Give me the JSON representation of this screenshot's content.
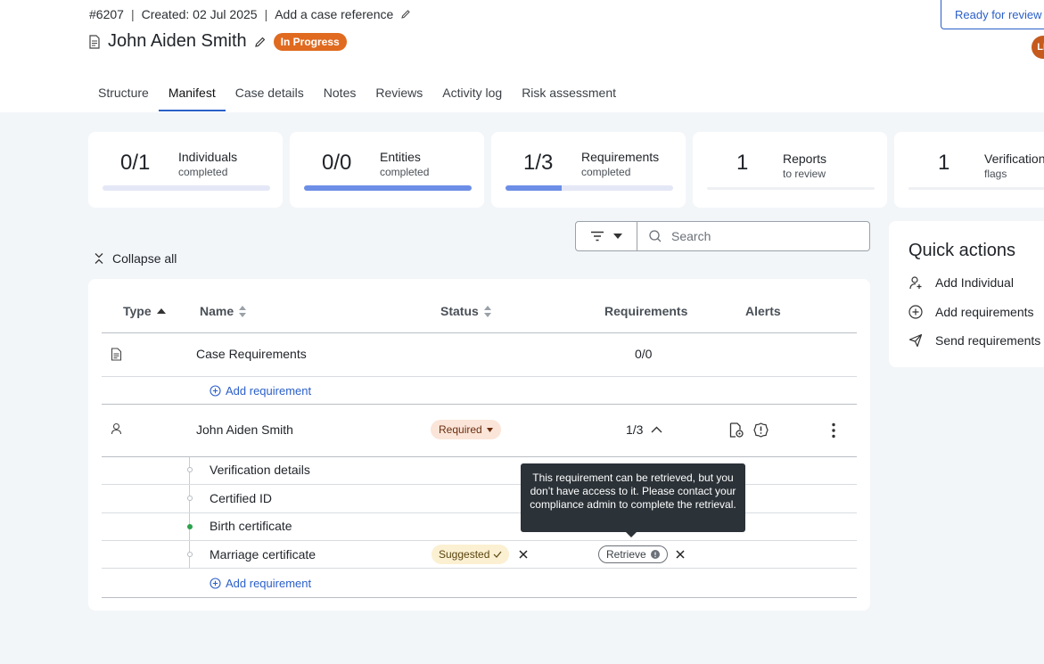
{
  "header": {
    "case_id": "#6207",
    "created": "Created: 02 Jul 2025",
    "case_reference": "Add a case reference",
    "title": "John Aiden Smith",
    "status": "In Progress",
    "ready_button": "Ready for review",
    "avatar_initials": "LL"
  },
  "tabs": [
    {
      "label": "Structure"
    },
    {
      "label": "Manifest"
    },
    {
      "label": "Case details"
    },
    {
      "label": "Notes"
    },
    {
      "label": "Reviews"
    },
    {
      "label": "Activity log"
    },
    {
      "label": "Risk assessment"
    }
  ],
  "stats": [
    {
      "value": "0/1",
      "label": "Individuals",
      "sub": "completed",
      "progress": 0
    },
    {
      "value": "0/0",
      "label": "Entities",
      "sub": "completed",
      "progress": 1
    },
    {
      "value": "1/3",
      "label": "Requirements",
      "sub": "completed",
      "progress": 0.333
    },
    {
      "value": "1",
      "label": "Reports",
      "sub": "to review"
    },
    {
      "value": "1",
      "label": "Verification",
      "sub": "flags"
    }
  ],
  "toolbar": {
    "search_placeholder": "Search",
    "collapse_label": "Collapse all"
  },
  "quick_actions": {
    "title": "Quick actions",
    "items": [
      {
        "label": "Add Individual",
        "icon": "add-person-icon"
      },
      {
        "label": "Add requirements",
        "icon": "plus-circle-icon"
      },
      {
        "label": "Send requirements",
        "icon": "send-icon"
      }
    ]
  },
  "table": {
    "columns": [
      "Type",
      "Name",
      "Status",
      "Requirements",
      "Alerts"
    ],
    "case_row": {
      "name": "Case Requirements",
      "requirements": "0/0",
      "add_label": "Add requirement"
    },
    "person_row": {
      "name": "John Aiden Smith",
      "status": "Required",
      "requirements": "1/3"
    },
    "sub_rows": [
      {
        "name": "Verification details",
        "done": false
      },
      {
        "name": "Certified ID",
        "done": false
      },
      {
        "name": "Birth certificate",
        "done": true
      },
      {
        "name": "Marriage certificate",
        "done": false,
        "status": "Suggested",
        "action": "Retrieve"
      }
    ],
    "person_add_label": "Add requirement"
  },
  "tooltip": "This requirement can be retrieved, but you don’t have access to it. Please contact your compliance admin to complete the retrieval.",
  "colors": {
    "accent": "#2b5fc8",
    "in_progress": "#e06a1f",
    "progress_fill": "#6c8ee6"
  }
}
